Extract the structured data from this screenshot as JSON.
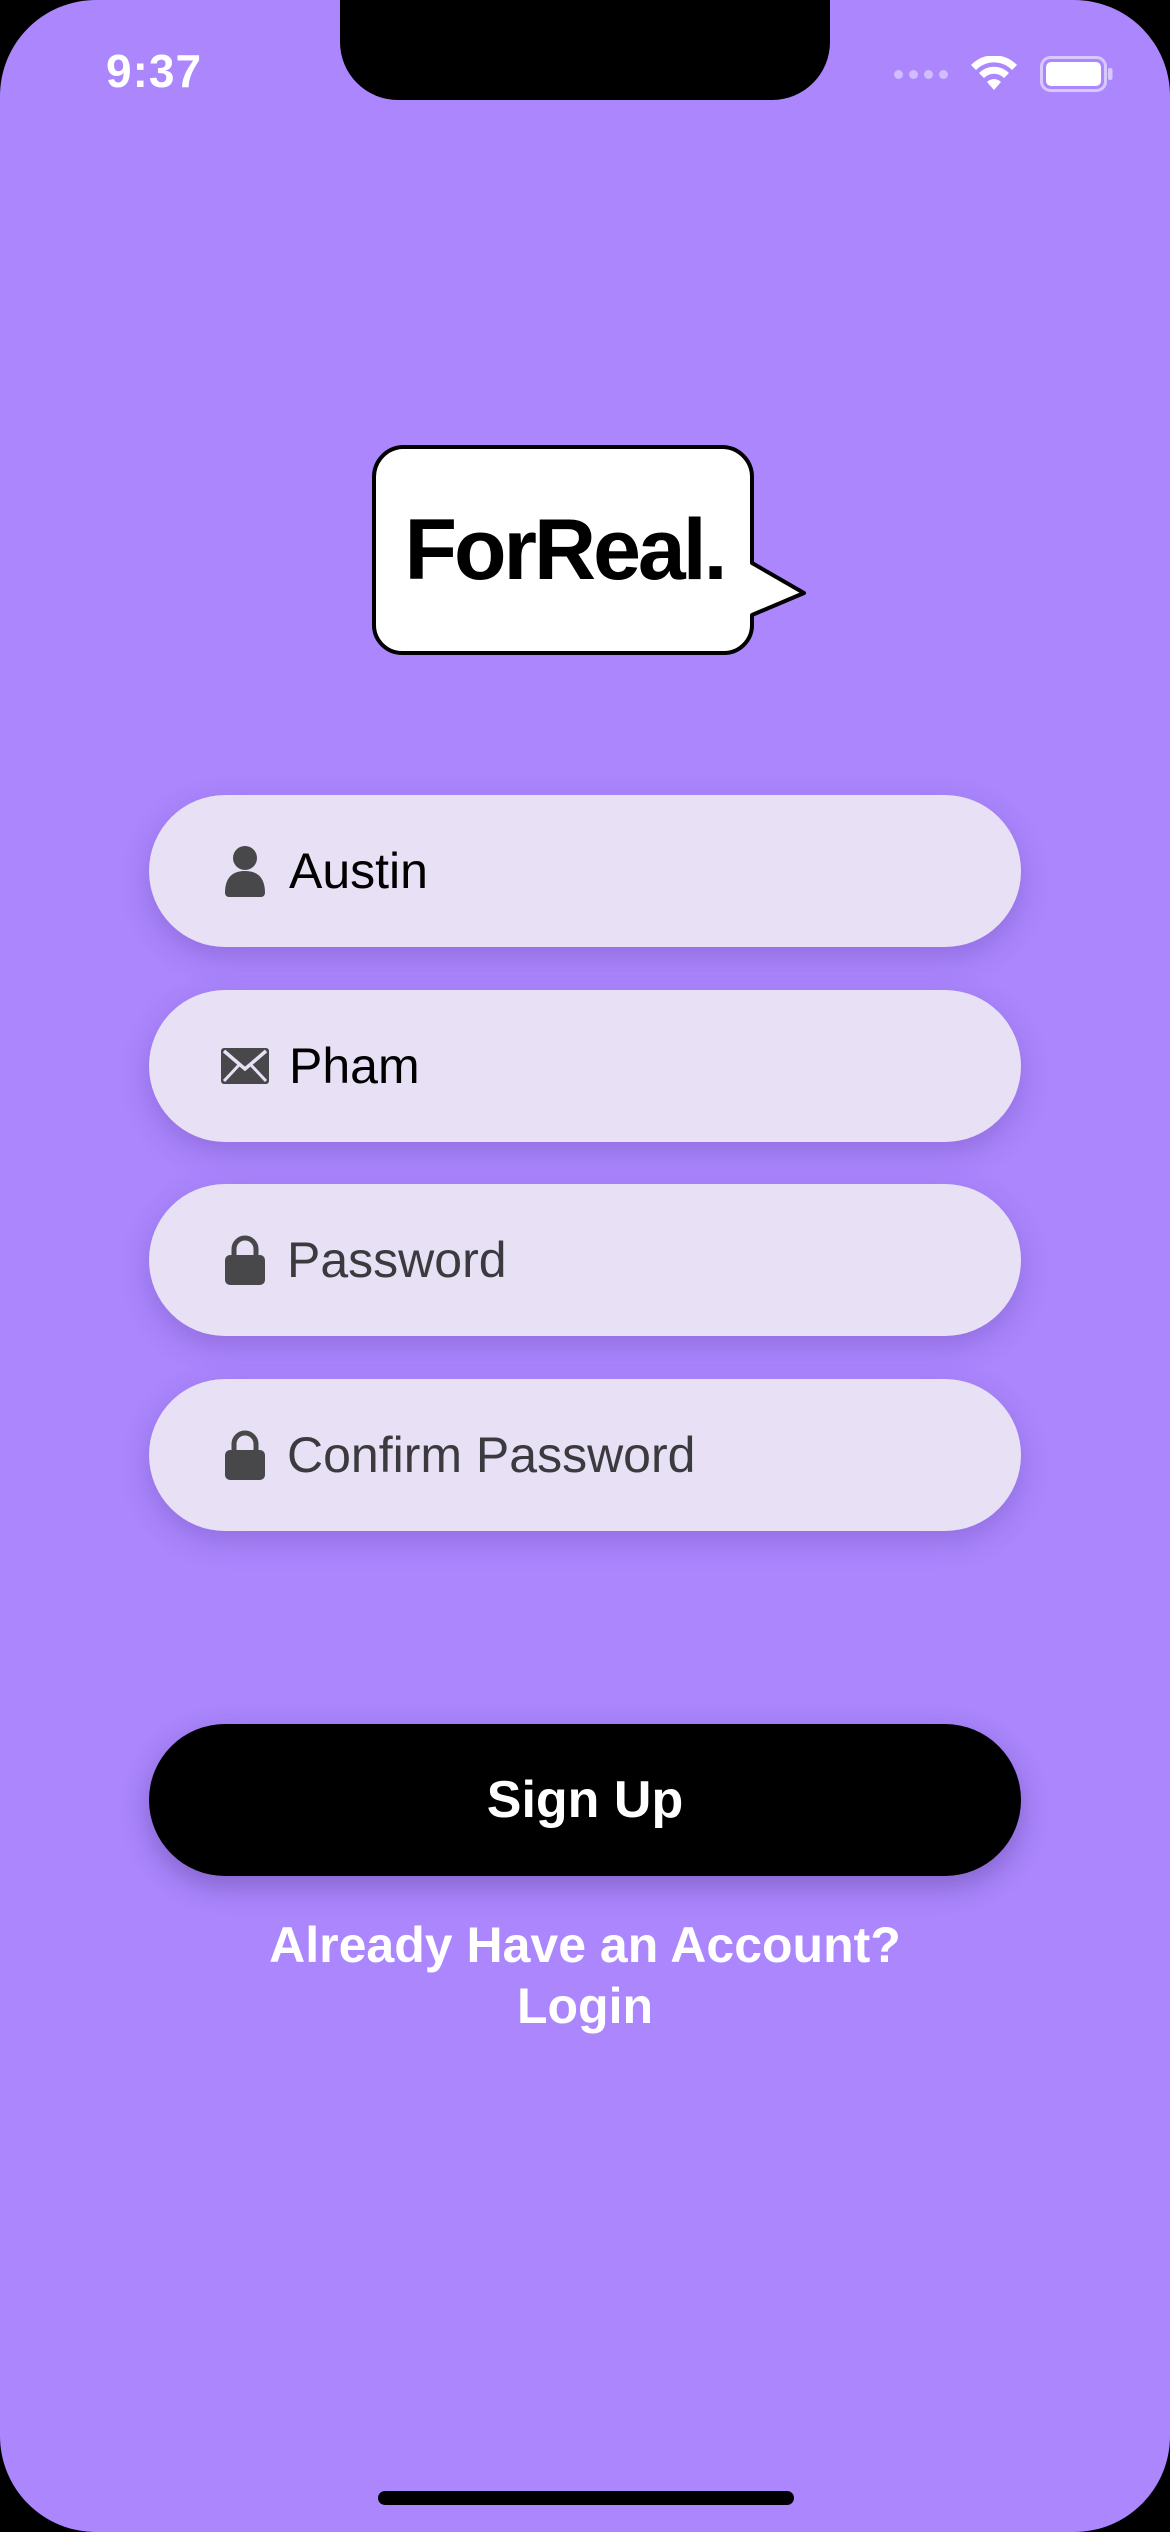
{
  "status_bar": {
    "time": "9:37"
  },
  "logo": {
    "text": "ForReal."
  },
  "form": {
    "first_name": {
      "value": "Austin",
      "icon": "person-icon"
    },
    "email": {
      "value": "Pham",
      "icon": "envelope-icon"
    },
    "password": {
      "placeholder": "Password",
      "icon": "lock-icon"
    },
    "confirm_password": {
      "placeholder": "Confirm Password",
      "icon": "lock-icon"
    }
  },
  "signup_button": {
    "label": "Sign Up"
  },
  "login_link": {
    "line1": "Already Have an Account?",
    "line2": "Login"
  },
  "colors": {
    "background": "#ab86fd",
    "field_background": "#e8e0f5",
    "button": "#000000",
    "text_light": "#ffffff"
  }
}
